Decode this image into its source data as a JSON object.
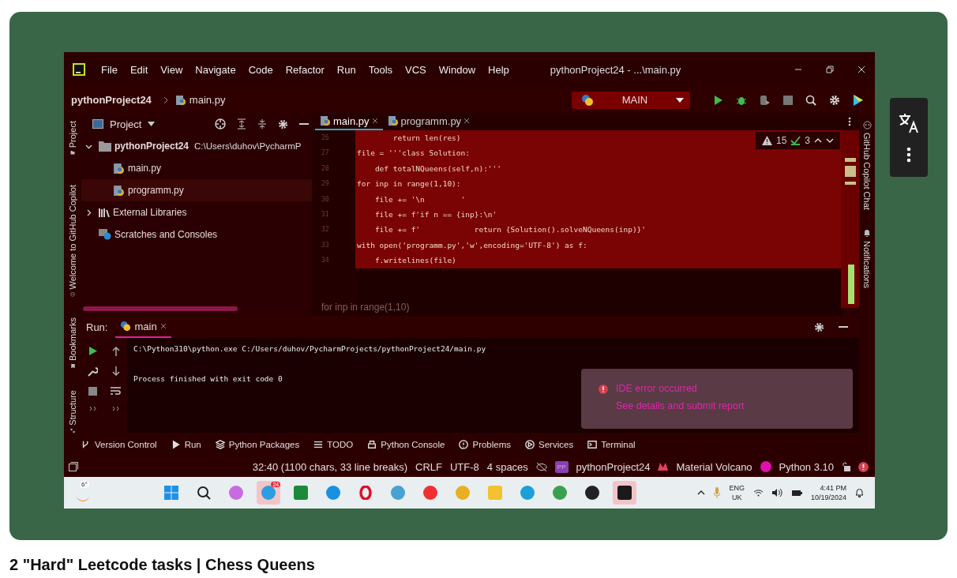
{
  "video": {
    "menu": [
      "File",
      "Edit",
      "View",
      "Navigate",
      "Code",
      "Refactor",
      "Run",
      "Tools",
      "VCS",
      "Window",
      "Help"
    ],
    "window_title": "pythonProject24 - ...\\main.py",
    "breadcrumb": {
      "project": "pythonProject24",
      "file": "main.py"
    },
    "run_config": "MAIN",
    "left_stripe": [
      "Project",
      "Welcome to GitHub Copilot",
      "Bookmarks",
      "Structure"
    ],
    "right_stripe": [
      "GitHub Copilot Chat",
      "Notifications"
    ],
    "project_panel": {
      "title": "Project",
      "tree": [
        {
          "label": "pythonProject24",
          "path": "C:\\Users\\duhov\\PycharmP",
          "kind": "folder",
          "expanded": true,
          "selected": false,
          "children": [
            {
              "label": "main.py",
              "kind": "file",
              "selected": false
            },
            {
              "label": "programm.py",
              "kind": "file",
              "selected": true
            }
          ]
        },
        {
          "label": "External Libraries",
          "kind": "library",
          "expanded": false,
          "selected": false
        },
        {
          "label": "Scratches and Consoles",
          "kind": "scratch",
          "selected": false
        }
      ]
    },
    "editor_tabs": [
      {
        "label": "main.py",
        "selected": true
      },
      {
        "label": "programm.py",
        "selected": false
      }
    ],
    "inspections": {
      "warnings": "15",
      "weak_warnings": "3"
    },
    "code_lines": [
      {
        "number": "26",
        "text": "        return len(res)",
        "selected": true
      },
      {
        "number": "27",
        "text": "file = '''class Solution:",
        "selected": true
      },
      {
        "number": "28",
        "text": "    def totalNQueens(self,n):'''",
        "selected": true
      },
      {
        "number": "29",
        "text": "for inp in range(1,10):",
        "selected": true
      },
      {
        "number": "30",
        "text": "    file += '\\n        '",
        "selected": true
      },
      {
        "number": "31",
        "text": "    file += f'if n == {inp}:\\n'",
        "selected": true
      },
      {
        "number": "32",
        "text": "    file += f'            return {Solution().solveNQueens(inp)}'",
        "selected": true
      },
      {
        "number": "33",
        "text": "with open('programm.py','w',encoding='UTF-8') as f:",
        "selected": true
      },
      {
        "number": "34",
        "text": "    f.writelines(file)",
        "selected": true
      }
    ],
    "hint": "for inp in range(1,10)",
    "run_panel": {
      "label": "Run:",
      "tab": "main",
      "output": [
        {
          "text": "C:\\Python310\\python.exe C:/Users/duhov/PycharmProjects/pythonProject24/main.py"
        },
        {
          "text": "Process finished with exit code 0"
        }
      ]
    },
    "notification": {
      "title": "IDE error occurred",
      "link": "See details and submit report"
    },
    "tool_tabs": [
      {
        "label": "Version Control",
        "kind": "vcs"
      },
      {
        "label": "Run",
        "kind": "run"
      },
      {
        "label": "Python Packages",
        "kind": "packages"
      },
      {
        "label": "TODO",
        "kind": "todo"
      },
      {
        "label": "Python Console",
        "kind": "console"
      },
      {
        "label": "Problems",
        "kind": "problems"
      },
      {
        "label": "Services",
        "kind": "services"
      },
      {
        "label": "Terminal",
        "kind": "terminal"
      }
    ],
    "status": {
      "position": "32:40 (1100 chars, 33 line breaks)",
      "line_separator": "CRLF",
      "encoding": "UTF-8",
      "indent": "4 spaces",
      "project_badge": "PP",
      "project": "pythonProject24",
      "theme": "Material Volcano",
      "interpreter": "Python 3.10"
    },
    "taskbar": {
      "weather": "6°",
      "messenger_badge": "24",
      "language": "ENG",
      "region": "UK",
      "time": "4:41 PM",
      "date": "10/19/2024"
    }
  },
  "video_title": "2 \"Hard\" Leetcode tasks | Chess Queens"
}
